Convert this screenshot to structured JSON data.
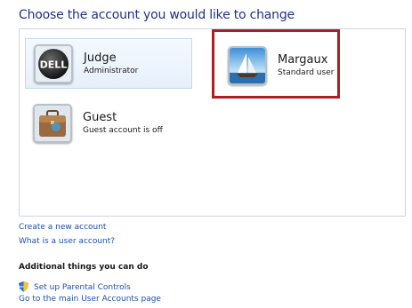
{
  "heading": "Choose the account you would like to change",
  "accounts": [
    {
      "name": "Judge",
      "role": "Administrator",
      "icon": "dell-logo-icon"
    },
    {
      "name": "Margaux",
      "role": "Standard user",
      "icon": "sailboat-icon"
    },
    {
      "name": "Guest",
      "role": "Guest account is off",
      "icon": "briefcase-icon"
    }
  ],
  "links": {
    "create": "Create a new account",
    "what_is": "What is a user account?"
  },
  "additional": {
    "heading": "Additional things you can do",
    "parental": "Set up Parental Controls",
    "main_page": "Go to the main User Accounts page"
  },
  "colors": {
    "heading": "#1e3287",
    "link": "#1e4fae",
    "highlight": "#b01e23"
  }
}
